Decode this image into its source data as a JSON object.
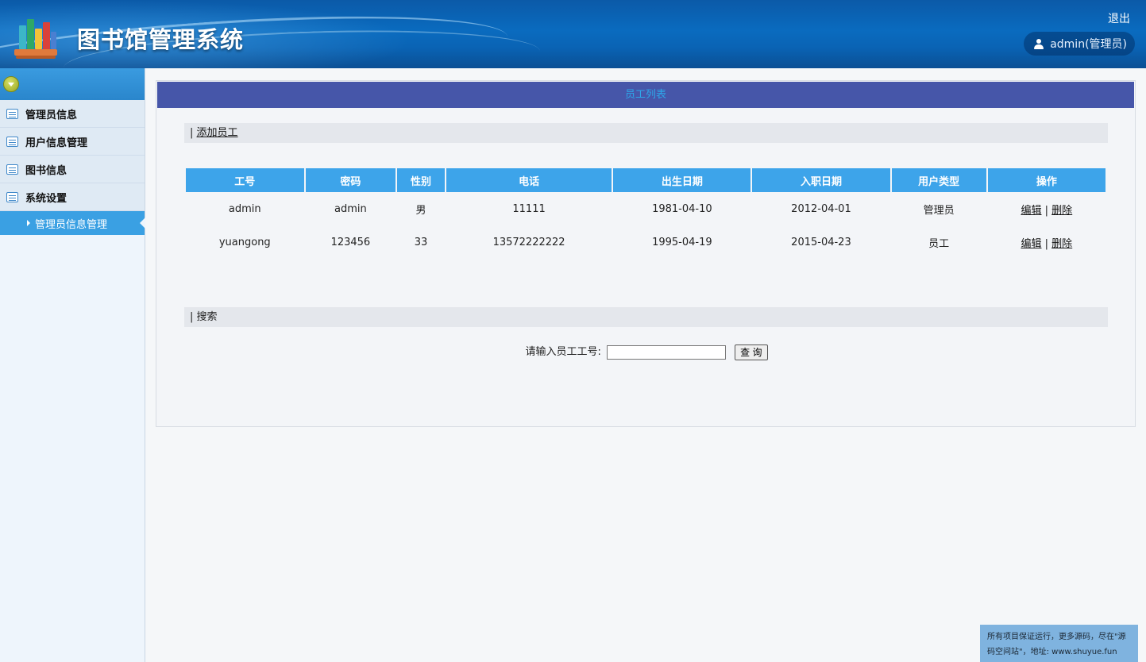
{
  "header": {
    "title": "图书馆管理系统",
    "logout_label": "退出",
    "user_label": "admin(管理员)"
  },
  "sidebar": {
    "items": [
      {
        "label": "管理员信息",
        "icon": "list-icon"
      },
      {
        "label": "用户信息管理",
        "icon": "list-icon"
      },
      {
        "label": "图书信息",
        "icon": "list-icon"
      },
      {
        "label": "系统设置",
        "icon": "list-icon"
      }
    ],
    "active_sub_item": "管理员信息管理"
  },
  "main": {
    "panel_title": "员工列表",
    "add_section_prefix": "| ",
    "add_link": "添加员工",
    "table": {
      "headers": [
        "工号",
        "密码",
        "性别",
        "电话",
        "出生日期",
        "入职日期",
        "用户类型",
        "操作"
      ],
      "rows": [
        [
          "admin",
          "admin",
          "男",
          "11111",
          "1981-04-10",
          "2012-04-01",
          "管理员"
        ],
        [
          "yuangong",
          "123456",
          "33",
          "13572222222",
          "1995-04-19",
          "2015-04-23",
          "员工"
        ]
      ],
      "edit_label": "编辑",
      "action_separator": "|",
      "delete_label": "删除"
    },
    "search_section": "| 搜索",
    "search_label": "请输入员工工号:",
    "search_value": "",
    "search_button": "查 询"
  },
  "watermark": "所有项目保证运行，更多源码，尽在\"源码空间站\"，地址: www.shuyue.fun",
  "colors": {
    "header_bg": "#0a6bbf",
    "panel_title_bg": "#4656a9",
    "panel_title_text": "#2da7ea",
    "table_header_bg": "#3da4ea",
    "active_menu_bg": "#3aa0e3"
  }
}
